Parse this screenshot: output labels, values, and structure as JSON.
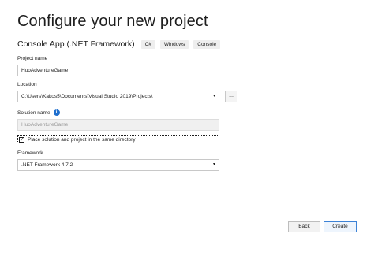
{
  "dialog": {
    "title": "Configure your new project"
  },
  "template": {
    "name": "Console App (.NET Framework)",
    "tags": [
      "C#",
      "Windows",
      "Console"
    ]
  },
  "project_name": {
    "label": "Project name",
    "value": "HuoAdventureGame"
  },
  "location": {
    "label": "Location",
    "value": "C:\\Users\\Kakos5\\Documents\\Visual Studio 2019\\Projects\\",
    "browse_label": "..."
  },
  "solution_name": {
    "label": "Solution name",
    "value": "HuoAdventureGame",
    "info_icon": "info-icon"
  },
  "same_directory": {
    "label": "Place solution and project in the same directory",
    "checked": true,
    "check_glyph": "✓"
  },
  "framework": {
    "label": "Framework",
    "value": ".NET Framework 4.7.2"
  },
  "buttons": {
    "back": "Back",
    "create": "Create"
  },
  "colors": {
    "accent": "#1f6fce",
    "primary_border": "#3c82d6"
  }
}
